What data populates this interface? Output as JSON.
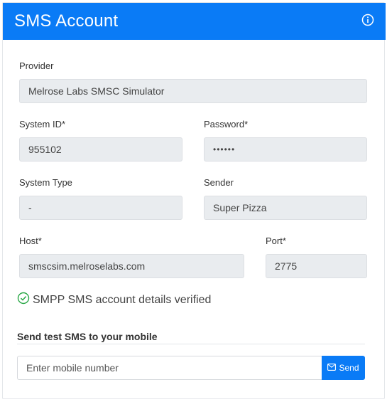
{
  "header": {
    "title": "SMS Account",
    "info_icon": "info-circle-icon"
  },
  "form": {
    "provider": {
      "label": "Provider",
      "value": "Melrose Labs SMSC Simulator"
    },
    "system_id": {
      "label": "System ID*",
      "value": "955102"
    },
    "password": {
      "label": "Password*",
      "value": "••••••"
    },
    "system_type": {
      "label": "System Type",
      "value": "-"
    },
    "sender": {
      "label": "Sender",
      "value": "Super Pizza"
    },
    "host": {
      "label": "Host*",
      "value": "smscsim.melroselabs.com"
    },
    "port": {
      "label": "Port*",
      "value": "2775"
    }
  },
  "status": {
    "text": "SMPP SMS account details verified",
    "icon": "check-circle-icon",
    "color": "#28a745"
  },
  "test_sms": {
    "title": "Send test SMS to your mobile",
    "placeholder": "Enter mobile number",
    "send_label": "Send",
    "send_icon": "envelope-icon"
  },
  "colors": {
    "accent": "#0a7bf6",
    "field_bg": "#e9ecef"
  }
}
